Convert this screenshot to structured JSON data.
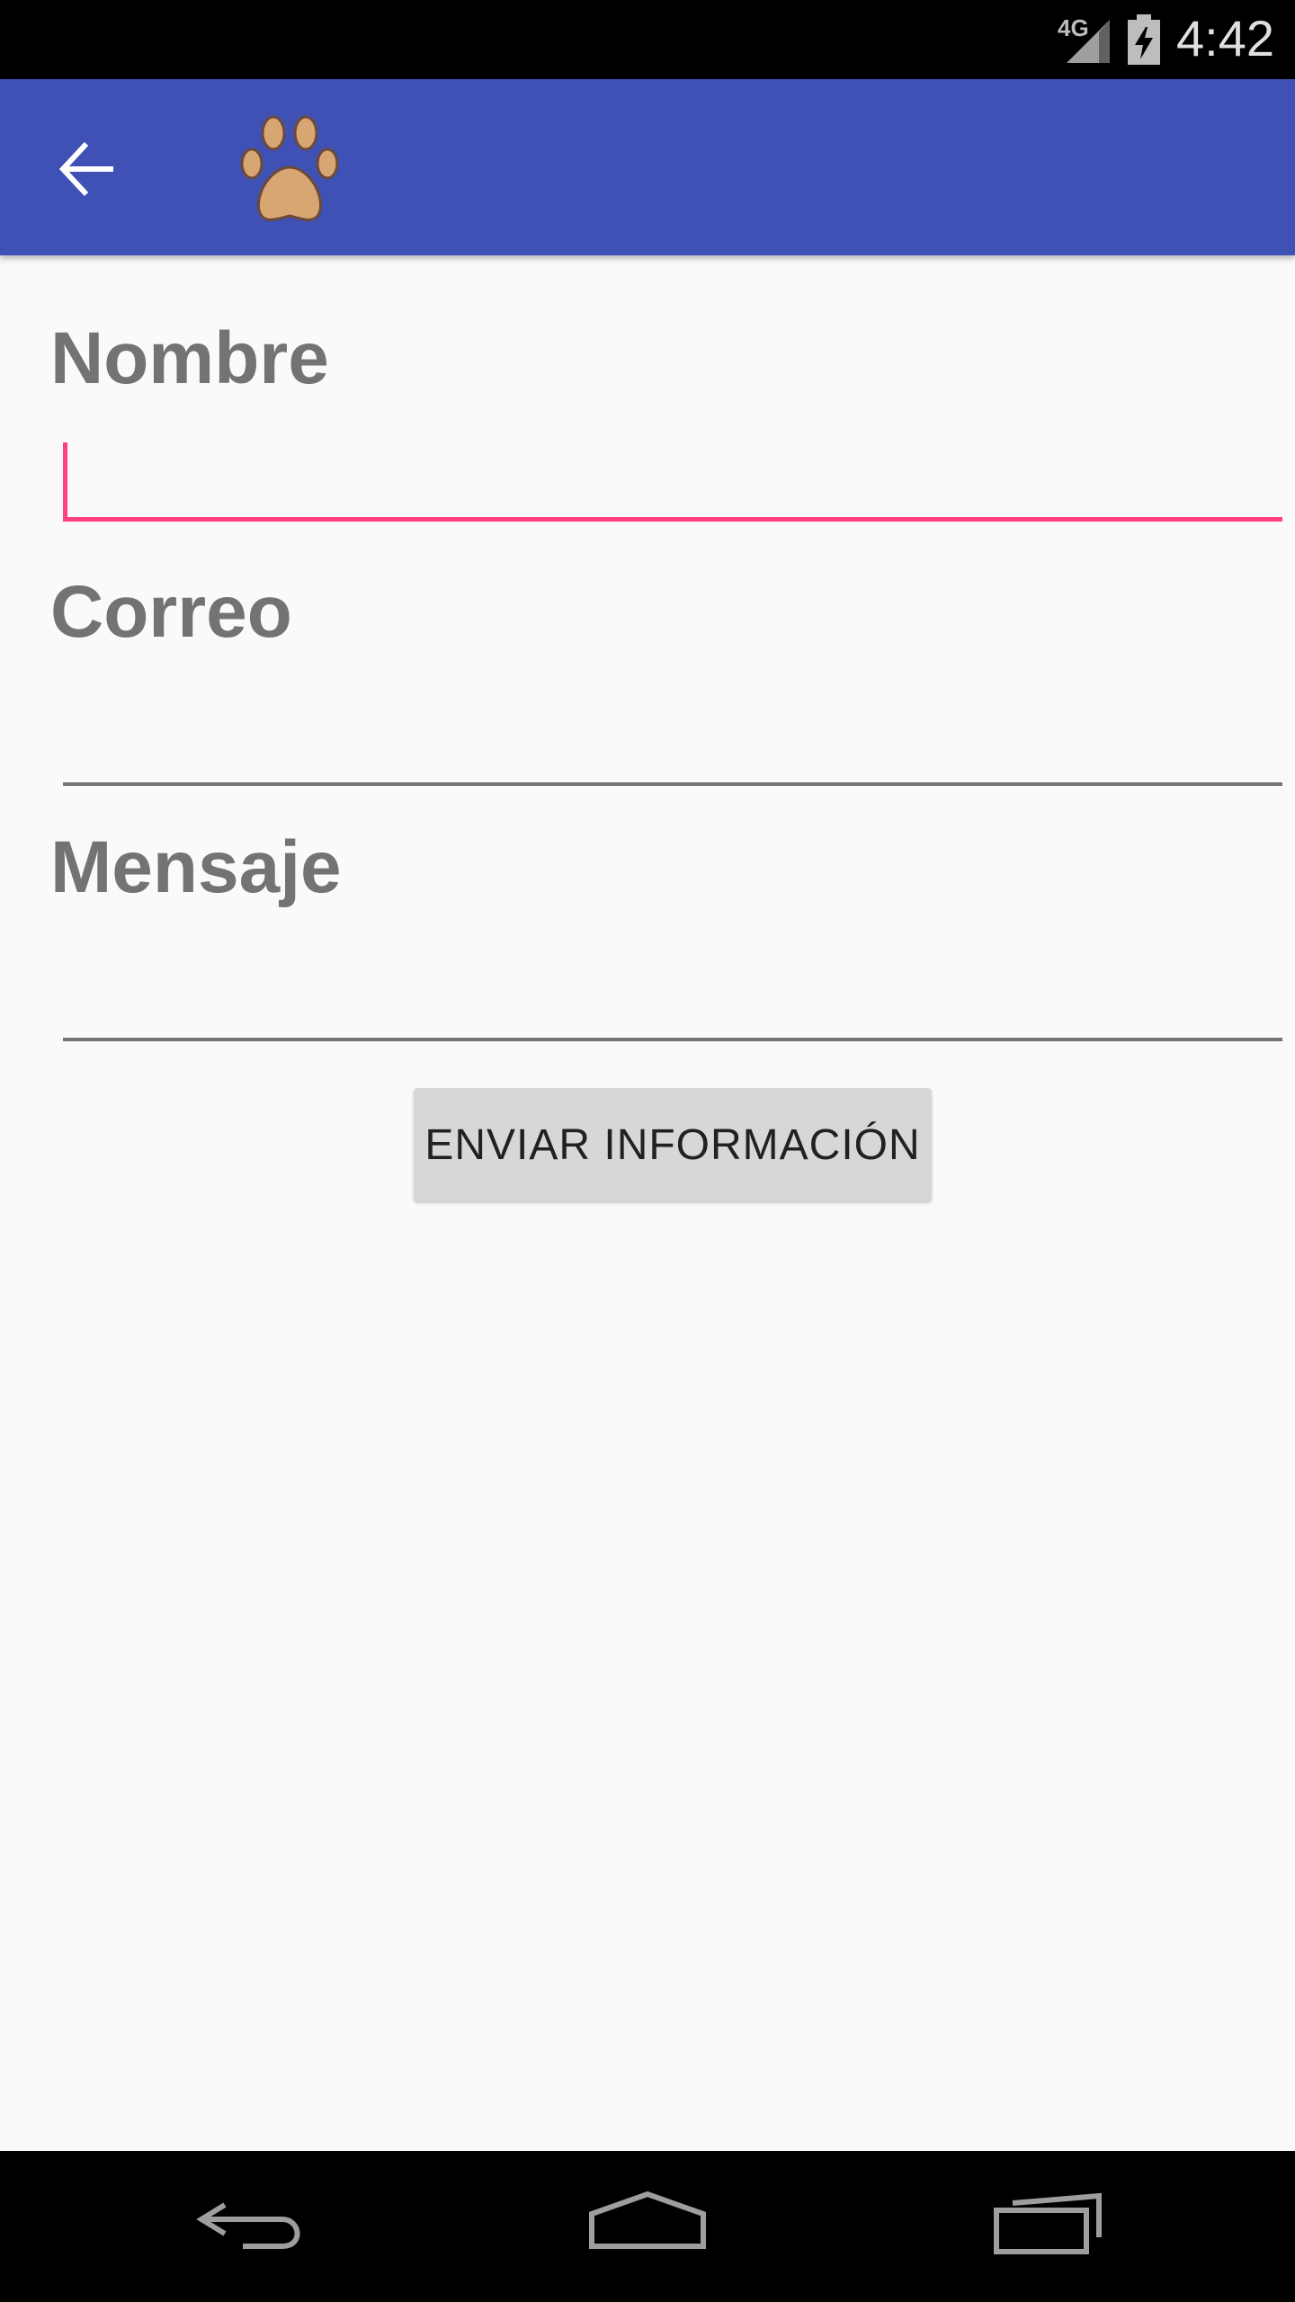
{
  "status_bar": {
    "network": "4G",
    "time": "4:42",
    "icons": [
      "signal-icon",
      "battery-charging-icon"
    ]
  },
  "app_bar": {
    "back_icon": "arrow-left-icon",
    "logo_icon": "paw-icon",
    "color": "#3f51b5"
  },
  "form": {
    "name_label": "Nombre",
    "name_value": "",
    "email_label": "Correo",
    "email_value": "",
    "message_label": "Mensaje",
    "message_value": "",
    "submit_label": "ENVIAR INFORMACIÓN",
    "accent_color": "#ff4081"
  },
  "nav_bar": {
    "icons": [
      "back-nav-icon",
      "home-nav-icon",
      "recents-nav-icon"
    ]
  }
}
